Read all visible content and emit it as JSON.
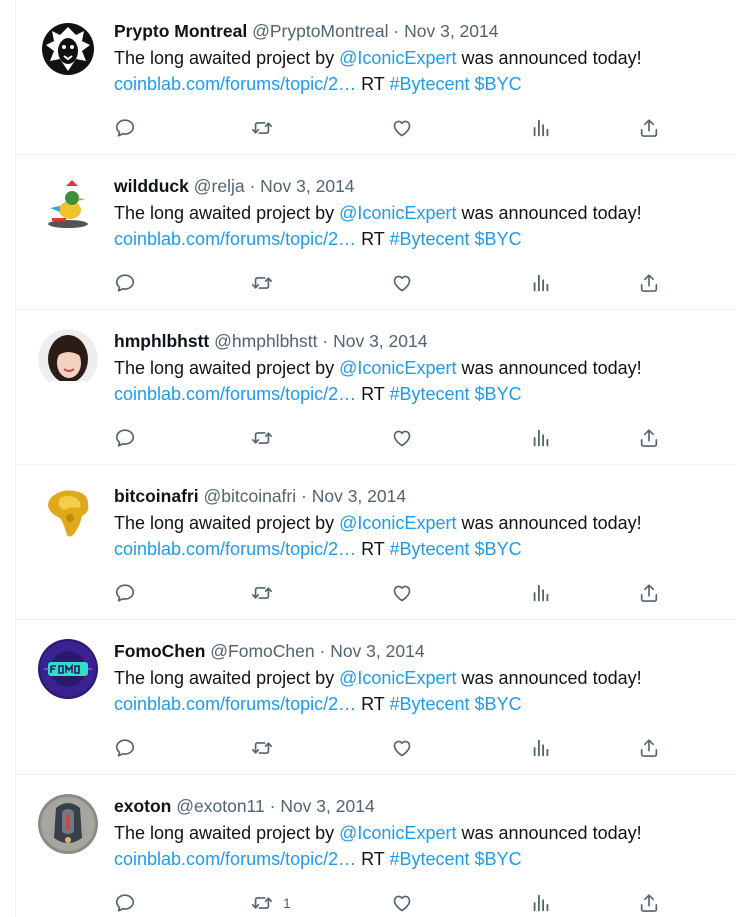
{
  "colors": {
    "link": "#1d9bf0",
    "text": "#0f1419",
    "secondary": "#536471",
    "divider": "#eff3f4"
  },
  "tweets": [
    {
      "name": "Prypto Montreal",
      "handle": "@PryptoMontreal",
      "sep": "·",
      "date": "Nov 3, 2014",
      "text_before": "The long awaited project by ",
      "mention": "@IconicExpert",
      "text_after": " was announced today!",
      "url": "coinblab.com/forums/topic/2…",
      "rt": " RT ",
      "hashtag": "#Bytecent",
      "cashtag": "$BYC",
      "avatar_icon": "lion-logo-avatar",
      "retweet_count": ""
    },
    {
      "name": "wildduck",
      "handle": "@relja",
      "sep": "·",
      "date": "Nov 3, 2014",
      "text_before": "The long awaited project by ",
      "mention": "@IconicExpert",
      "text_after": " was announced today!",
      "url": "coinblab.com/forums/topic/2…",
      "rt": " RT ",
      "hashtag": "#Bytecent",
      "cashtag": "$BYC",
      "avatar_icon": "duck-avatar",
      "retweet_count": ""
    },
    {
      "name": "hmphlbhstt",
      "handle": "@hmphlbhstt",
      "sep": "·",
      "date": "Nov 3, 2014",
      "text_before": "The long awaited project by ",
      "mention": "@IconicExpert",
      "text_after": " was announced today!",
      "url": "coinblab.com/forums/topic/2…",
      "rt": " RT ",
      "hashtag": "#Bytecent",
      "cashtag": "$BYC",
      "avatar_icon": "person-photo-avatar",
      "retweet_count": ""
    },
    {
      "name": "bitcoinafri",
      "handle": "@bitcoinafri",
      "sep": "·",
      "date": "Nov 3, 2014",
      "text_before": "The long awaited project by ",
      "mention": "@IconicExpert",
      "text_after": " was announced today!",
      "url": "coinblab.com/forums/topic/2…",
      "rt": " RT ",
      "hashtag": "#Bytecent",
      "cashtag": "$BYC",
      "avatar_icon": "gold-africa-avatar",
      "retweet_count": ""
    },
    {
      "name": "FomoChen",
      "handle": "@FomoChen",
      "sep": "·",
      "date": "Nov 3, 2014",
      "text_before": "The long awaited project by ",
      "mention": "@IconicExpert",
      "text_after": " was announced today!",
      "url": "coinblab.com/forums/topic/2…",
      "rt": " RT ",
      "hashtag": "#Bytecent",
      "cashtag": "$BYC",
      "avatar_icon": "fomo-logo-avatar",
      "retweet_count": ""
    },
    {
      "name": "exoton",
      "handle": "@exoton11",
      "sep": "·",
      "date": "Nov 3, 2014",
      "text_before": "The long awaited project by ",
      "mention": "@IconicExpert",
      "text_after": " was announced today!",
      "url": "coinblab.com/forums/topic/2…",
      "rt": " RT ",
      "hashtag": "#Bytecent",
      "cashtag": "$BYC",
      "avatar_icon": "helmet-avatar",
      "retweet_count": "1"
    }
  ]
}
